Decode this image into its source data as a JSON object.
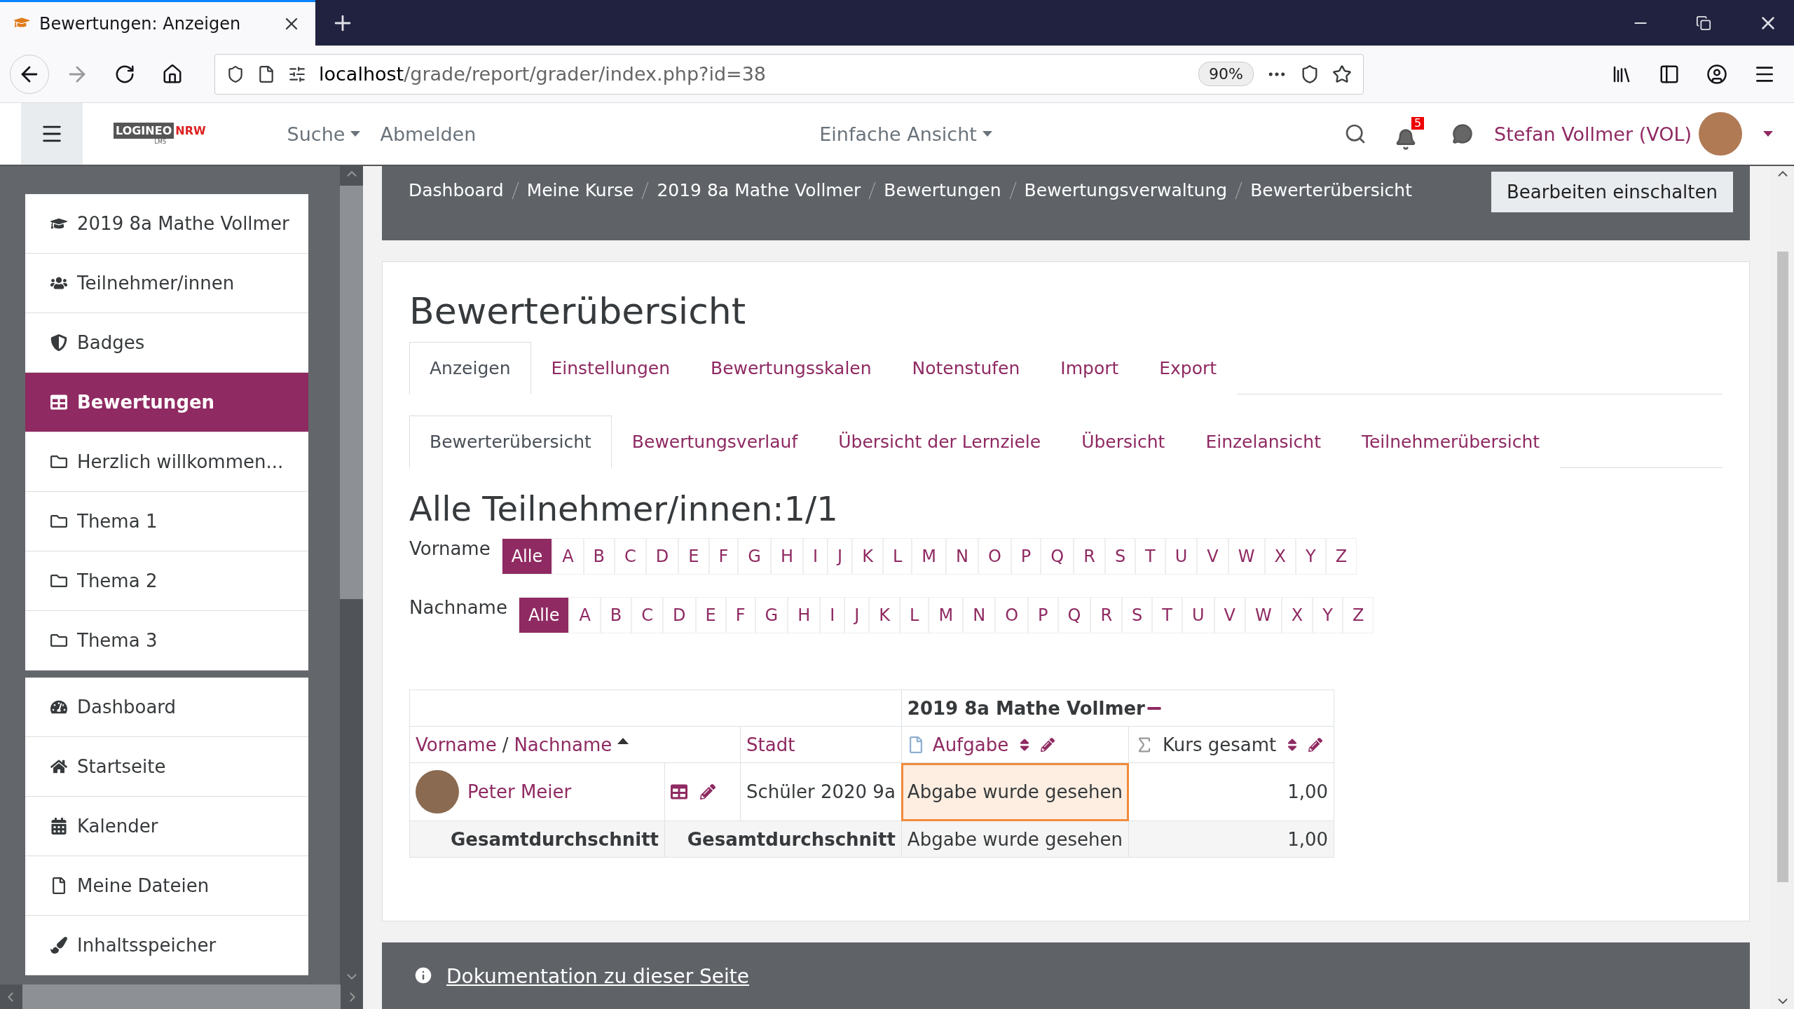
{
  "browser": {
    "tab_title": "Bewertungen: Anzeigen",
    "url_host": "localhost",
    "url_path": "/grade/report/grader/index.php?id=38",
    "zoom": "90%"
  },
  "header": {
    "logo": {
      "part1": "LOGINEO",
      "part2": "NRW",
      "part3": "LMS"
    },
    "search_menu": "Suche",
    "logout": "Abmelden",
    "view_menu": "Einfache Ansicht",
    "notifications": "5",
    "user": "Stefan Vollmer (VOL)"
  },
  "sidebar": {
    "groups": [
      [
        {
          "label": "2019 8a Mathe Vollmer",
          "selected": false
        },
        {
          "label": "Teilnehmer/innen",
          "selected": false
        },
        {
          "label": "Badges",
          "selected": false
        },
        {
          "label": "Bewertungen",
          "selected": true
        },
        {
          "label": "Herzlich willkommen...",
          "selected": false
        },
        {
          "label": "Thema 1",
          "selected": false
        },
        {
          "label": "Thema 2",
          "selected": false
        },
        {
          "label": "Thema 3",
          "selected": false
        }
      ],
      [
        {
          "label": "Dashboard",
          "selected": false
        },
        {
          "label": "Startseite",
          "selected": false
        },
        {
          "label": "Kalender",
          "selected": false
        },
        {
          "label": "Meine Dateien",
          "selected": false
        },
        {
          "label": "Inhaltsspeicher",
          "selected": false
        }
      ]
    ]
  },
  "breadcrumb": [
    "Dashboard",
    "Meine Kurse",
    "2019 8a Mathe Vollmer",
    "Bewertungen",
    "Bewertungsverwaltung",
    "Bewerterübersicht"
  ],
  "edit_button": "Bearbeiten einschalten",
  "page_title": "Bewerterübersicht",
  "tabs": [
    {
      "label": "Anzeigen",
      "selected": true
    },
    {
      "label": "Einstellungen",
      "selected": false
    },
    {
      "label": "Bewertungsskalen",
      "selected": false
    },
    {
      "label": "Notenstufen",
      "selected": false
    },
    {
      "label": "Import",
      "selected": false
    },
    {
      "label": "Export",
      "selected": false
    }
  ],
  "subtabs": [
    {
      "label": "Bewerterübersicht",
      "selected": true
    },
    {
      "label": "Bewertungsverlauf",
      "selected": false
    },
    {
      "label": "Übersicht der Lernziele",
      "selected": false
    },
    {
      "label": "Übersicht",
      "selected": false
    },
    {
      "label": "Einzelansicht",
      "selected": false
    },
    {
      "label": "Teilnehmerübersicht",
      "selected": false
    }
  ],
  "participants_heading": "Alle Teilnehmer/innen:1/1",
  "filters": [
    {
      "label": "Vorname",
      "letters": [
        {
          "label": "Alle",
          "selected": true
        },
        {
          "label": "A",
          "selected": false
        },
        {
          "label": "B",
          "selected": false
        },
        {
          "label": "C",
          "selected": false
        },
        {
          "label": "D",
          "selected": false
        },
        {
          "label": "E",
          "selected": false
        },
        {
          "label": "F",
          "selected": false
        },
        {
          "label": "G",
          "selected": false
        },
        {
          "label": "H",
          "selected": false
        },
        {
          "label": "I",
          "selected": false
        },
        {
          "label": "J",
          "selected": false
        },
        {
          "label": "K",
          "selected": false
        },
        {
          "label": "L",
          "selected": false
        },
        {
          "label": "M",
          "selected": false
        },
        {
          "label": "N",
          "selected": false
        },
        {
          "label": "O",
          "selected": false
        },
        {
          "label": "P",
          "selected": false
        },
        {
          "label": "Q",
          "selected": false
        },
        {
          "label": "R",
          "selected": false
        },
        {
          "label": "S",
          "selected": false
        },
        {
          "label": "T",
          "selected": false
        },
        {
          "label": "U",
          "selected": false
        },
        {
          "label": "V",
          "selected": false
        },
        {
          "label": "W",
          "selected": false
        },
        {
          "label": "X",
          "selected": false
        },
        {
          "label": "Y",
          "selected": false
        },
        {
          "label": "Z",
          "selected": false
        }
      ]
    },
    {
      "label": "Nachname",
      "letters": [
        {
          "label": "Alle",
          "selected": true
        },
        {
          "label": "A",
          "selected": false
        },
        {
          "label": "B",
          "selected": false
        },
        {
          "label": "C",
          "selected": false
        },
        {
          "label": "D",
          "selected": false
        },
        {
          "label": "E",
          "selected": false
        },
        {
          "label": "F",
          "selected": false
        },
        {
          "label": "G",
          "selected": false
        },
        {
          "label": "H",
          "selected": false
        },
        {
          "label": "I",
          "selected": false
        },
        {
          "label": "J",
          "selected": false
        },
        {
          "label": "K",
          "selected": false
        },
        {
          "label": "L",
          "selected": false
        },
        {
          "label": "M",
          "selected": false
        },
        {
          "label": "N",
          "selected": false
        },
        {
          "label": "O",
          "selected": false
        },
        {
          "label": "P",
          "selected": false
        },
        {
          "label": "Q",
          "selected": false
        },
        {
          "label": "R",
          "selected": false
        },
        {
          "label": "S",
          "selected": false
        },
        {
          "label": "T",
          "selected": false
        },
        {
          "label": "U",
          "selected": false
        },
        {
          "label": "V",
          "selected": false
        },
        {
          "label": "W",
          "selected": false
        },
        {
          "label": "X",
          "selected": false
        },
        {
          "label": "Y",
          "selected": false
        },
        {
          "label": "Z",
          "selected": false
        }
      ]
    }
  ],
  "table": {
    "course": "2019 8a Mathe Vollmer",
    "name_columns": [
      "Vorname",
      "Nachname"
    ],
    "name_separator": "/",
    "city_column": "Stadt",
    "grade_column": "Aufgabe",
    "total_column": "Kurs gesamt",
    "rows": [
      {
        "name": "Peter Meier",
        "city": "Schüler 2020 9a",
        "grade": "Abgabe wurde gesehen",
        "grade_highlighted": true,
        "total": "1,00"
      }
    ],
    "average": {
      "label_1": "Gesamtdurchschnitt",
      "label_2": "Gesamtdurchschnitt",
      "grade": "Abgabe wurde gesehen",
      "total": "1,00"
    }
  },
  "footer_link": "Dokumentation zu dieser Seite"
}
